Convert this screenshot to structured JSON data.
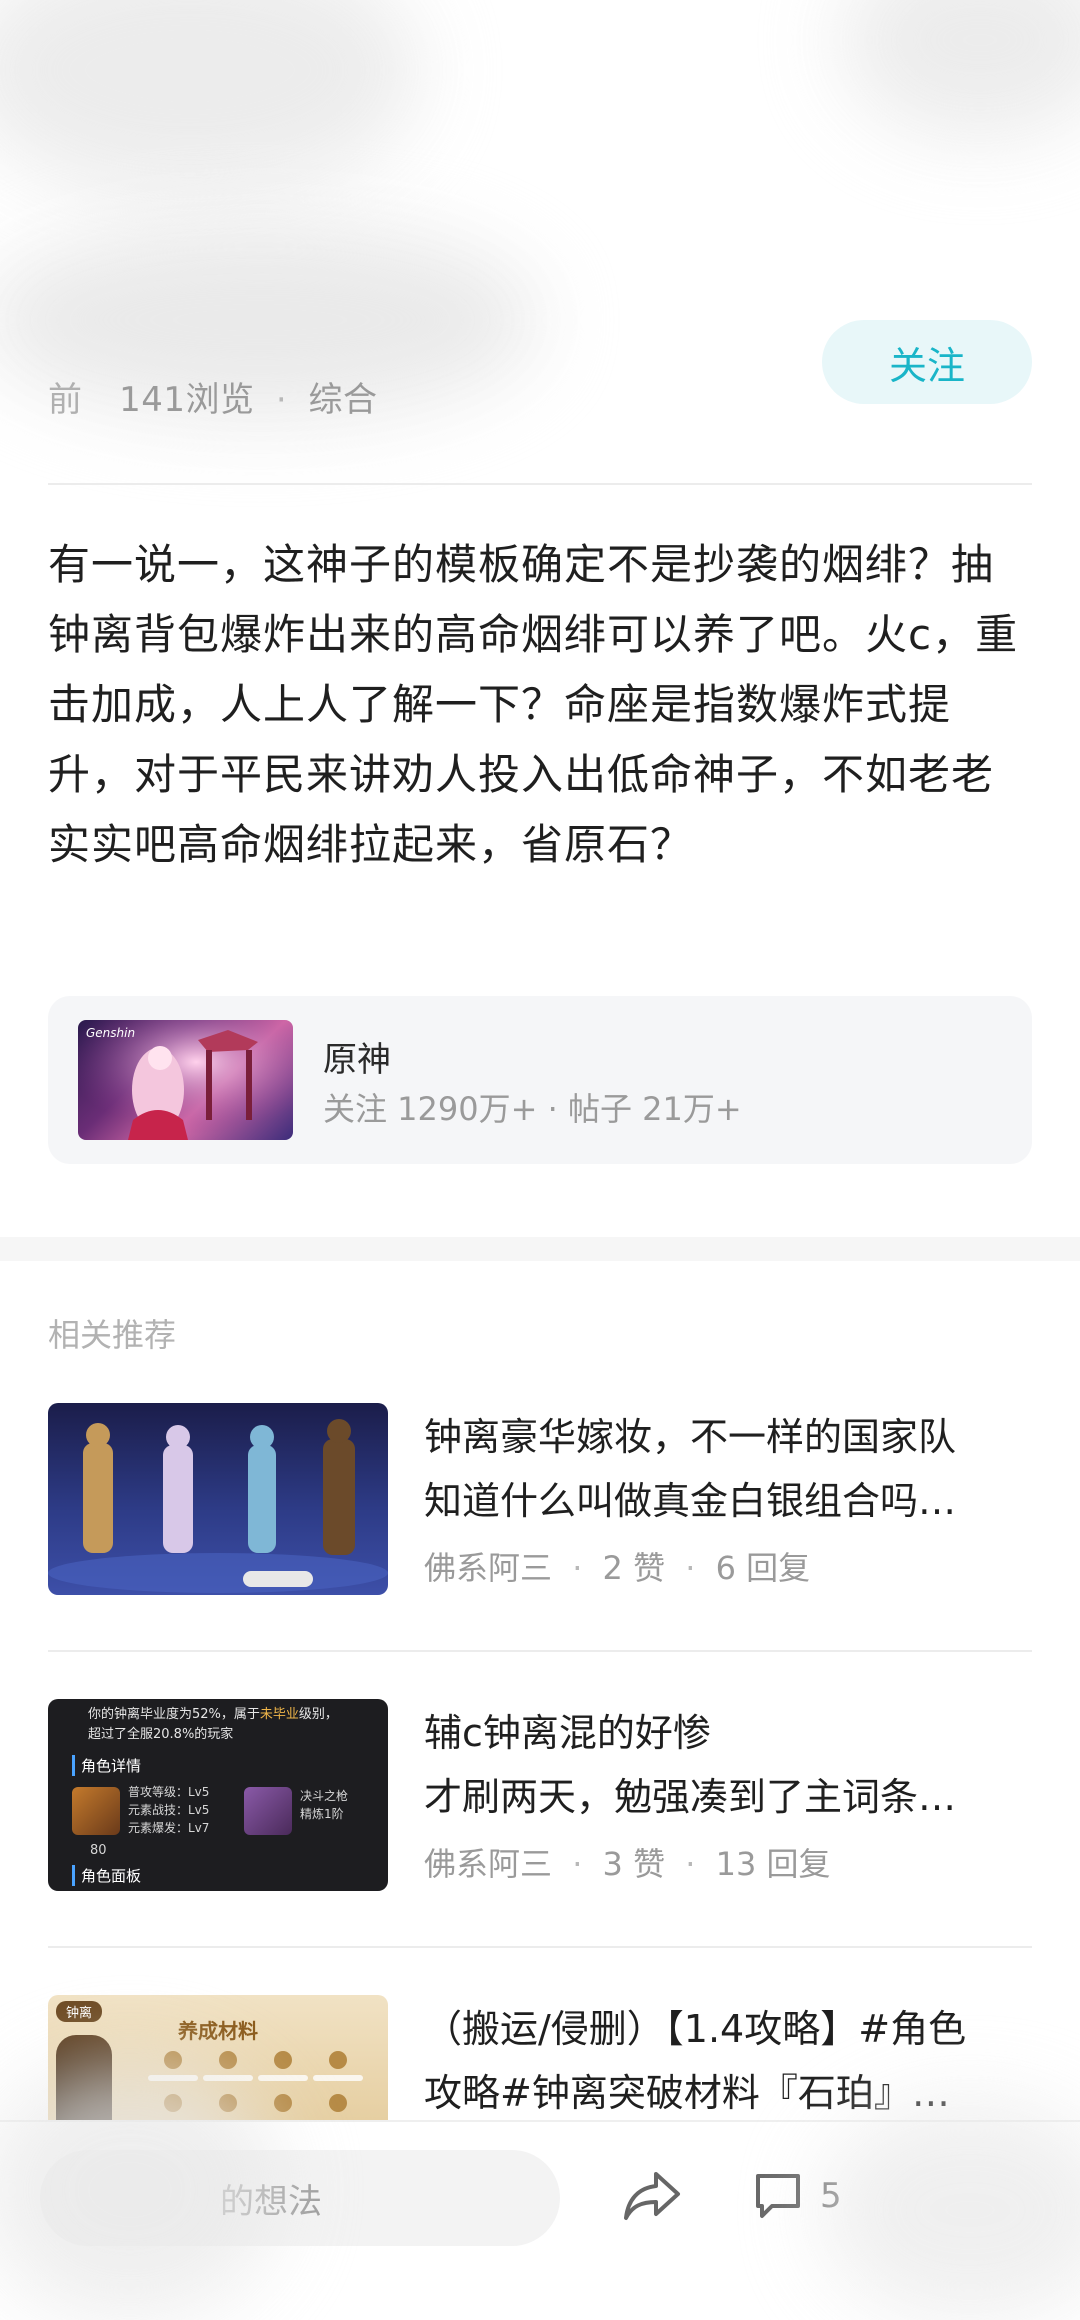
{
  "header": {
    "meta_prefix": "前",
    "views": "141浏览",
    "separator": "·",
    "category": "综合",
    "follow_label": "关注"
  },
  "post": {
    "body": "有一说一，这神子的模板确定不是抄袭的烟绯？抽钟离背包爆炸出来的高命烟绯可以养了吧。火c，重击加成，人上人了解一下？命座是指数爆炸式提升，对于平民来讲劝人投入出低命神子，不如老老实实吧高命烟绯拉起来，省原石？"
  },
  "forum": {
    "name": "原神",
    "stats": "关注 1290万+ · 帖子 21万+",
    "thumb_logo": "Genshin"
  },
  "related": {
    "title": "相关推荐",
    "items": [
      {
        "title": "钟离豪华嫁妆，不一样的国家队",
        "subtitle": "知道什么叫做真金白银组合吗…",
        "author": "佛系阿三",
        "likes": "2 赞",
        "replies": "6 回复"
      },
      {
        "title": "辅c钟离混的好惨",
        "subtitle": "才刷两天，勉强凑到了主词条…",
        "author": "佛系阿三",
        "likes": "3 赞",
        "replies": "13 回复",
        "thumb_text": {
          "line1": "你的钟离毕业度为52%，属于",
          "badge": "未毕业",
          "line1_end": "级别，",
          "line2": "超过了全服20.8%的玩家",
          "section": "角色详情",
          "stats": "普攻等级：Lv5\n元素战技：Lv5\n元素爆发：Lv7",
          "level": "80",
          "weapon_name": "决斗之枪",
          "weapon_refine": "精炼1阶",
          "panel": "角色面板"
        }
      },
      {
        "title": "（搬运/侵删）【1.4攻略】#角色",
        "subtitle": "攻略#钟离突破材料『石珀』…",
        "thumb_text": {
          "tag": "钟离",
          "heading": "养成材料"
        }
      }
    ]
  },
  "bottom": {
    "comment_placeholder": "的想法",
    "comment_count": "5",
    "share_icon": "share-icon",
    "comment_icon": "comment-icon"
  },
  "colors": {
    "accent": "#19b5c8",
    "follow_bg": "#e8f7f9",
    "meta": "#9a9a9a"
  }
}
